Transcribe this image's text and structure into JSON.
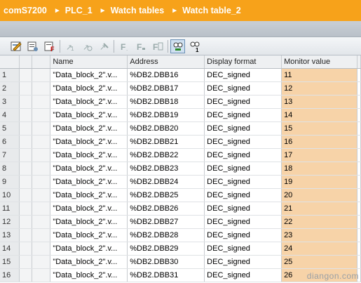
{
  "breadcrumb": [
    "comS7200",
    "PLC_1",
    "Watch tables",
    "Watch table_2"
  ],
  "toolbar_icons": [
    "insert-row-icon",
    "monitor-table-icon",
    "filter-icon",
    "modify-now-icon",
    "modify-trigger-icon",
    "modify-disable-icon",
    "force-icon",
    "force-one-icon",
    "force-all-icon",
    "monitor-all-icon",
    "monitor-once-icon"
  ],
  "columns": [
    "Name",
    "Address",
    "Display format",
    "Monitor value"
  ],
  "rows": [
    {
      "idx": "1",
      "name": "\"Data_block_2\".v...",
      "address": "%DB2.DBB16",
      "format": "DEC_signed",
      "value": "11"
    },
    {
      "idx": "2",
      "name": "\"Data_block_2\".v...",
      "address": "%DB2.DBB17",
      "format": "DEC_signed",
      "value": "12"
    },
    {
      "idx": "3",
      "name": "\"Data_block_2\".v...",
      "address": "%DB2.DBB18",
      "format": "DEC_signed",
      "value": "13"
    },
    {
      "idx": "4",
      "name": "\"Data_block_2\".v...",
      "address": "%DB2.DBB19",
      "format": "DEC_signed",
      "value": "14"
    },
    {
      "idx": "5",
      "name": "\"Data_block_2\".v...",
      "address": "%DB2.DBB20",
      "format": "DEC_signed",
      "value": "15"
    },
    {
      "idx": "6",
      "name": "\"Data_block_2\".v...",
      "address": "%DB2.DBB21",
      "format": "DEC_signed",
      "value": "16"
    },
    {
      "idx": "7",
      "name": "\"Data_block_2\".v...",
      "address": "%DB2.DBB22",
      "format": "DEC_signed",
      "value": "17"
    },
    {
      "idx": "8",
      "name": "\"Data_block_2\".v...",
      "address": "%DB2.DBB23",
      "format": "DEC_signed",
      "value": "18"
    },
    {
      "idx": "9",
      "name": "\"Data_block_2\".v...",
      "address": "%DB2.DBB24",
      "format": "DEC_signed",
      "value": "19"
    },
    {
      "idx": "10",
      "name": "\"Data_block_2\".v...",
      "address": "%DB2.DBB25",
      "format": "DEC_signed",
      "value": "20"
    },
    {
      "idx": "11",
      "name": "\"Data_block_2\".v...",
      "address": "%DB2.DBB26",
      "format": "DEC_signed",
      "value": "21"
    },
    {
      "idx": "12",
      "name": "\"Data_block_2\".v...",
      "address": "%DB2.DBB27",
      "format": "DEC_signed",
      "value": "22"
    },
    {
      "idx": "13",
      "name": "\"Data_block_2\".v...",
      "address": "%DB2.DBB28",
      "format": "DEC_signed",
      "value": "23"
    },
    {
      "idx": "14",
      "name": "\"Data_block_2\".v...",
      "address": "%DB2.DBB29",
      "format": "DEC_signed",
      "value": "24"
    },
    {
      "idx": "15",
      "name": "\"Data_block_2\".v...",
      "address": "%DB2.DBB30",
      "format": "DEC_signed",
      "value": "25"
    },
    {
      "idx": "16",
      "name": "\"Data_block_2\".v...",
      "address": "%DB2.DBB31",
      "format": "DEC_signed",
      "value": "26"
    }
  ],
  "watermark": "diangon.com",
  "colors": {
    "title_bar": "#f7a21a",
    "monitor_cell": "#f7d3a8"
  }
}
